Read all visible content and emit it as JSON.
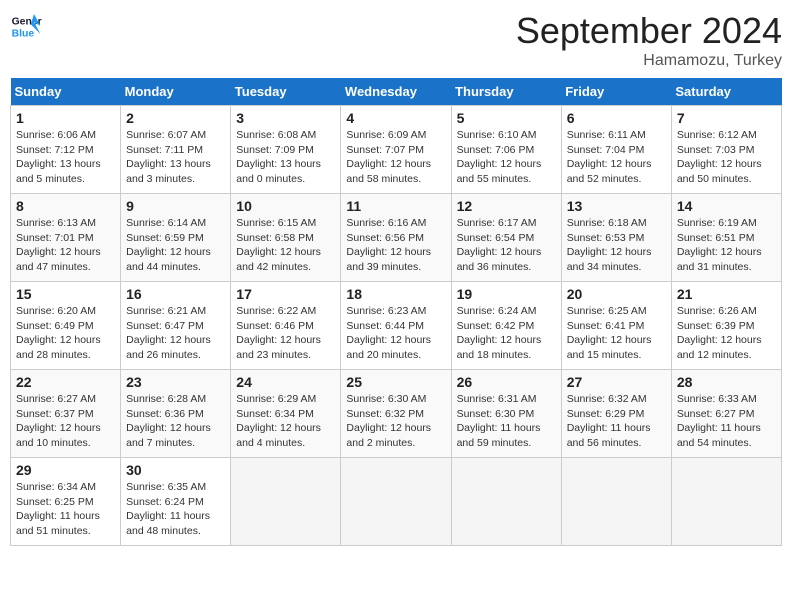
{
  "header": {
    "logo_line1": "General",
    "logo_line2": "Blue",
    "month": "September 2024",
    "location": "Hamamozu, Turkey"
  },
  "days_of_week": [
    "Sunday",
    "Monday",
    "Tuesday",
    "Wednesday",
    "Thursday",
    "Friday",
    "Saturday"
  ],
  "weeks": [
    [
      {
        "day": 1,
        "sunrise": "6:06 AM",
        "sunset": "7:12 PM",
        "daylight": "13 hours and 5 minutes."
      },
      {
        "day": 2,
        "sunrise": "6:07 AM",
        "sunset": "7:11 PM",
        "daylight": "13 hours and 3 minutes."
      },
      {
        "day": 3,
        "sunrise": "6:08 AM",
        "sunset": "7:09 PM",
        "daylight": "13 hours and 0 minutes."
      },
      {
        "day": 4,
        "sunrise": "6:09 AM",
        "sunset": "7:07 PM",
        "daylight": "12 hours and 58 minutes."
      },
      {
        "day": 5,
        "sunrise": "6:10 AM",
        "sunset": "7:06 PM",
        "daylight": "12 hours and 55 minutes."
      },
      {
        "day": 6,
        "sunrise": "6:11 AM",
        "sunset": "7:04 PM",
        "daylight": "12 hours and 52 minutes."
      },
      {
        "day": 7,
        "sunrise": "6:12 AM",
        "sunset": "7:03 PM",
        "daylight": "12 hours and 50 minutes."
      }
    ],
    [
      {
        "day": 8,
        "sunrise": "6:13 AM",
        "sunset": "7:01 PM",
        "daylight": "12 hours and 47 minutes."
      },
      {
        "day": 9,
        "sunrise": "6:14 AM",
        "sunset": "6:59 PM",
        "daylight": "12 hours and 44 minutes."
      },
      {
        "day": 10,
        "sunrise": "6:15 AM",
        "sunset": "6:58 PM",
        "daylight": "12 hours and 42 minutes."
      },
      {
        "day": 11,
        "sunrise": "6:16 AM",
        "sunset": "6:56 PM",
        "daylight": "12 hours and 39 minutes."
      },
      {
        "day": 12,
        "sunrise": "6:17 AM",
        "sunset": "6:54 PM",
        "daylight": "12 hours and 36 minutes."
      },
      {
        "day": 13,
        "sunrise": "6:18 AM",
        "sunset": "6:53 PM",
        "daylight": "12 hours and 34 minutes."
      },
      {
        "day": 14,
        "sunrise": "6:19 AM",
        "sunset": "6:51 PM",
        "daylight": "12 hours and 31 minutes."
      }
    ],
    [
      {
        "day": 15,
        "sunrise": "6:20 AM",
        "sunset": "6:49 PM",
        "daylight": "12 hours and 28 minutes."
      },
      {
        "day": 16,
        "sunrise": "6:21 AM",
        "sunset": "6:47 PM",
        "daylight": "12 hours and 26 minutes."
      },
      {
        "day": 17,
        "sunrise": "6:22 AM",
        "sunset": "6:46 PM",
        "daylight": "12 hours and 23 minutes."
      },
      {
        "day": 18,
        "sunrise": "6:23 AM",
        "sunset": "6:44 PM",
        "daylight": "12 hours and 20 minutes."
      },
      {
        "day": 19,
        "sunrise": "6:24 AM",
        "sunset": "6:42 PM",
        "daylight": "12 hours and 18 minutes."
      },
      {
        "day": 20,
        "sunrise": "6:25 AM",
        "sunset": "6:41 PM",
        "daylight": "12 hours and 15 minutes."
      },
      {
        "day": 21,
        "sunrise": "6:26 AM",
        "sunset": "6:39 PM",
        "daylight": "12 hours and 12 minutes."
      }
    ],
    [
      {
        "day": 22,
        "sunrise": "6:27 AM",
        "sunset": "6:37 PM",
        "daylight": "12 hours and 10 minutes."
      },
      {
        "day": 23,
        "sunrise": "6:28 AM",
        "sunset": "6:36 PM",
        "daylight": "12 hours and 7 minutes."
      },
      {
        "day": 24,
        "sunrise": "6:29 AM",
        "sunset": "6:34 PM",
        "daylight": "12 hours and 4 minutes."
      },
      {
        "day": 25,
        "sunrise": "6:30 AM",
        "sunset": "6:32 PM",
        "daylight": "12 hours and 2 minutes."
      },
      {
        "day": 26,
        "sunrise": "6:31 AM",
        "sunset": "6:30 PM",
        "daylight": "11 hours and 59 minutes."
      },
      {
        "day": 27,
        "sunrise": "6:32 AM",
        "sunset": "6:29 PM",
        "daylight": "11 hours and 56 minutes."
      },
      {
        "day": 28,
        "sunrise": "6:33 AM",
        "sunset": "6:27 PM",
        "daylight": "11 hours and 54 minutes."
      }
    ],
    [
      {
        "day": 29,
        "sunrise": "6:34 AM",
        "sunset": "6:25 PM",
        "daylight": "11 hours and 51 minutes."
      },
      {
        "day": 30,
        "sunrise": "6:35 AM",
        "sunset": "6:24 PM",
        "daylight": "11 hours and 48 minutes."
      },
      null,
      null,
      null,
      null,
      null
    ]
  ]
}
